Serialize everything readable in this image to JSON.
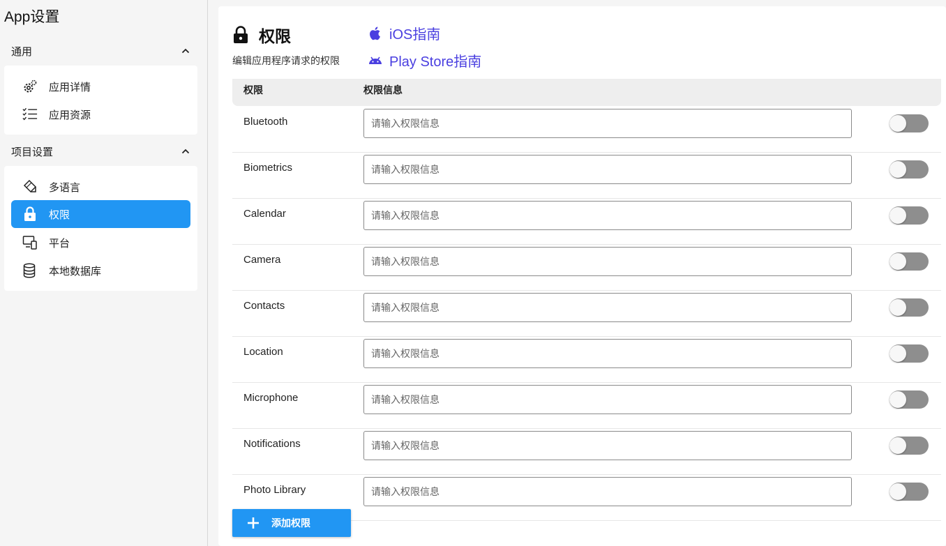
{
  "sidebar": {
    "app_title": "App设置",
    "sections": [
      {
        "title": "通用",
        "items": [
          {
            "label": "应用详情",
            "icon": "gears-icon",
            "active": false
          },
          {
            "label": "应用资源",
            "icon": "checklist-icon",
            "active": false
          }
        ]
      },
      {
        "title": "项目设置",
        "items": [
          {
            "label": "多语言",
            "icon": "translate-icon",
            "active": false
          },
          {
            "label": "权限",
            "icon": "lock-icon",
            "active": true
          },
          {
            "label": "平台",
            "icon": "devices-icon",
            "active": false
          },
          {
            "label": "本地数据库",
            "icon": "database-icon",
            "active": false
          }
        ]
      }
    ]
  },
  "main": {
    "title": "权限",
    "description": "编辑应用程序请求的权限",
    "links": [
      {
        "label": "iOS指南",
        "icon": "apple-icon"
      },
      {
        "label": "Play Store指南",
        "icon": "android-icon"
      }
    ],
    "table": {
      "headers": {
        "name": "权限",
        "info": "权限信息"
      },
      "placeholder": "请输入权限信息",
      "rows": [
        {
          "name": "Bluetooth",
          "value": "",
          "enabled": false
        },
        {
          "name": "Biometrics",
          "value": "",
          "enabled": false
        },
        {
          "name": "Calendar",
          "value": "",
          "enabled": false
        },
        {
          "name": "Camera",
          "value": "",
          "enabled": false
        },
        {
          "name": "Contacts",
          "value": "",
          "enabled": false
        },
        {
          "name": "Location",
          "value": "",
          "enabled": false
        },
        {
          "name": "Microphone",
          "value": "",
          "enabled": false
        },
        {
          "name": "Notifications",
          "value": "",
          "enabled": false
        },
        {
          "name": "Photo Library",
          "value": "",
          "enabled": false
        }
      ]
    },
    "add_button_label": "添加权限"
  },
  "colors": {
    "accent": "#2196f3",
    "link": "#4a3fe0",
    "toggle_off": "#8e8e8e"
  }
}
